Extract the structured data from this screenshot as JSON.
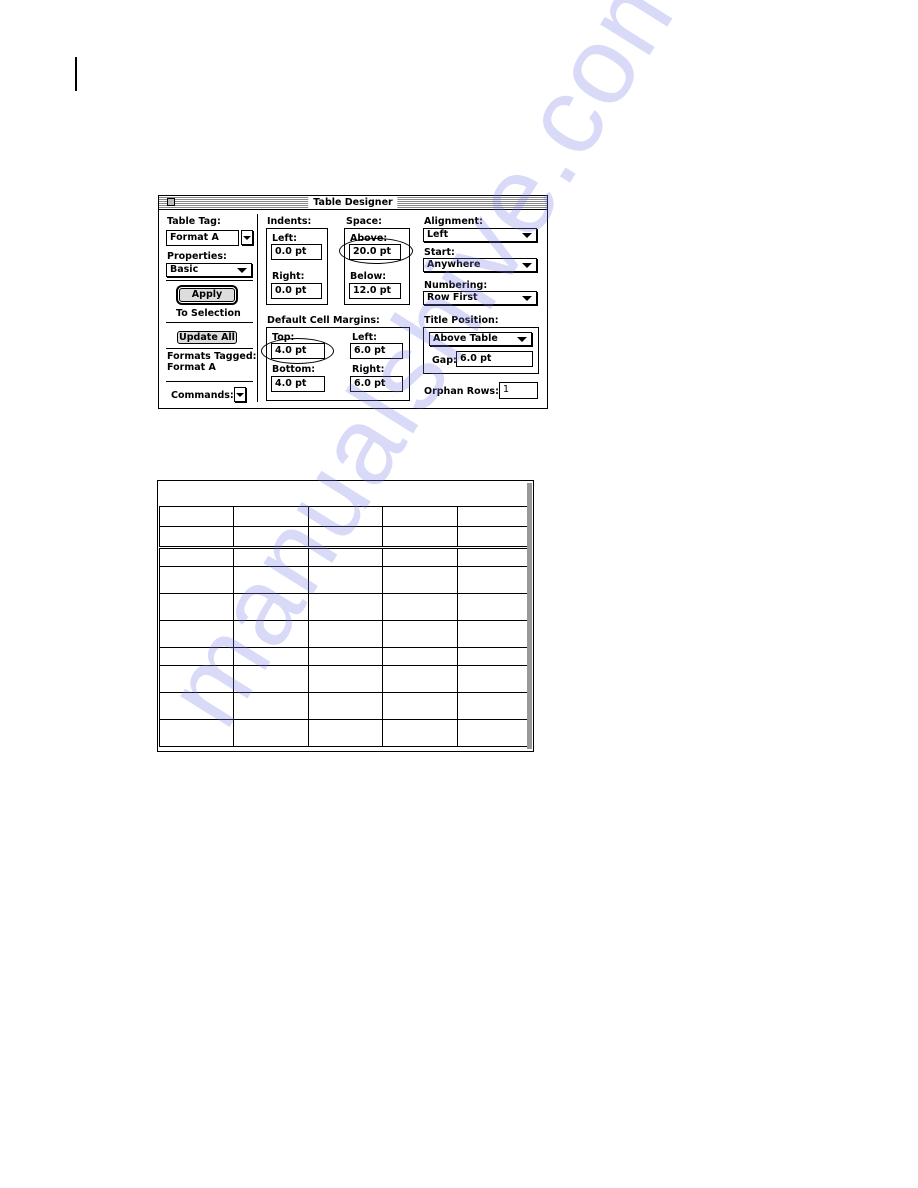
{
  "dialog": {
    "title": "Table Designer",
    "table_tag": {
      "label": "Table Tag:",
      "value": "Format A"
    },
    "properties": {
      "label": "Properties:",
      "value": "Basic"
    },
    "apply_button": "Apply",
    "to_selection": "To Selection",
    "update_all_button": "Update All",
    "formats_tagged": {
      "label": "Formats Tagged:",
      "value": "Format A"
    },
    "commands_label": "Commands:",
    "indents": {
      "label": "Indents:",
      "left_label": "Left:",
      "left_value": "0.0 pt",
      "right_label": "Right:",
      "right_value": "0.0 pt"
    },
    "space": {
      "label": "Space:",
      "above_label": "Above:",
      "above_value": "20.0 pt",
      "below_label": "Below:",
      "below_value": "12.0 pt"
    },
    "alignment": {
      "label": "Alignment:",
      "value": "Left"
    },
    "start": {
      "label": "Start:",
      "value": "Anywhere"
    },
    "numbering": {
      "label": "Numbering:",
      "value": "Row First"
    },
    "cell_margins": {
      "label": "Default Cell Margins:",
      "top_label": "Top:",
      "top_value": "4.0 pt",
      "bottom_label": "Bottom:",
      "bottom_value": "4.0 pt",
      "left_label": "Left:",
      "left_value": "6.0 pt",
      "right_label": "Right:",
      "right_value": "6.0 pt"
    },
    "title_position": {
      "label": "Title Position:",
      "value": "Above Table",
      "gap_label": "Gap:",
      "gap_value": "6.0 pt"
    },
    "orphan_rows": {
      "label": "Orphan Rows:",
      "value": "1"
    }
  },
  "table_illustration": {
    "columns": 5,
    "rows": [
      {
        "type": "heading"
      },
      {
        "type": "heading",
        "separator": "double"
      },
      {
        "type": "body"
      },
      {
        "type": "body-tall"
      },
      {
        "type": "body-tall"
      },
      {
        "type": "body-tall"
      },
      {
        "type": "body"
      },
      {
        "type": "body-tall"
      },
      {
        "type": "body-tall"
      },
      {
        "type": "body-tall"
      }
    ]
  },
  "watermark": "manualshive.com"
}
